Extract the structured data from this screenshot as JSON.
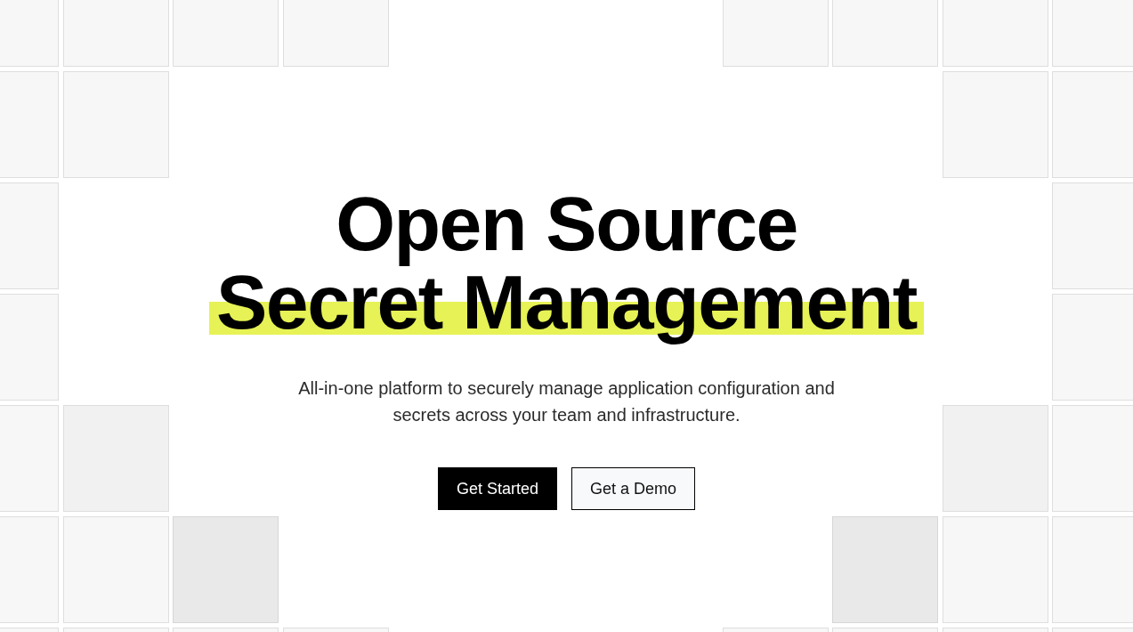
{
  "headline": [
    {
      "text": "Open Source",
      "highlighted": false
    },
    {
      "text": "Secret Management",
      "highlighted": true
    }
  ],
  "subtitle": "All-in-one platform to securely manage application configuration and secrets across your team and infrastructure.",
  "buttons": [
    {
      "label": "Get Started",
      "kind": "primary"
    },
    {
      "label": "Get a Demo",
      "kind": "secondary"
    }
  ]
}
